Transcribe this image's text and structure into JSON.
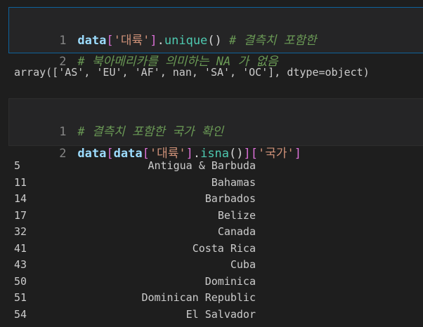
{
  "cell1": {
    "line1": {
      "number": "1",
      "var": "data",
      "open_bracket": "[",
      "string": "'대륙'",
      "close_bracket": "]",
      "dot": ".",
      "method": "unique",
      "parens": "()",
      "comment": " # 결측치 포함한"
    },
    "line2": {
      "number": "2",
      "comment": "# 북아메리카를 의미하는 NA 가 없음"
    }
  },
  "output1": {
    "text": "array(['AS', 'EU', 'AF', nan, 'SA', 'OC'], dtype=object)"
  },
  "cell2": {
    "line1": {
      "number": "1",
      "comment": "# 결측치 포함한 국가 확인"
    },
    "line2": {
      "number": "2",
      "var1": "data",
      "b1_open": "[",
      "var2": "data",
      "b2_open": "[",
      "str1": "'대륙'",
      "b2_close": "]",
      "dot": ".",
      "method": "isna",
      "parens": "()",
      "b1_close": "]",
      "b3_open": "[",
      "str2": "'국가'",
      "b3_close": "]"
    }
  },
  "output2": {
    "rows": [
      {
        "index": "5",
        "value": "Antigua & Barbuda"
      },
      {
        "index": "11",
        "value": "Bahamas"
      },
      {
        "index": "14",
        "value": "Barbados"
      },
      {
        "index": "17",
        "value": "Belize"
      },
      {
        "index": "32",
        "value": "Canada"
      },
      {
        "index": "41",
        "value": "Costa Rica"
      },
      {
        "index": "43",
        "value": "Cuba"
      },
      {
        "index": "50",
        "value": "Dominica"
      },
      {
        "index": "51",
        "value": "Dominican Republic"
      },
      {
        "index": "54",
        "value": "El Salvador"
      }
    ]
  },
  "colors": {
    "background": "#1e1e1e",
    "cell_background": "#252526",
    "active_cell_border": "#0e639c",
    "string": "#ce9178",
    "variable": "#9cdcfe",
    "method": "#4ec9b0",
    "bracket": "#da70d6",
    "comment": "#6a9955"
  }
}
